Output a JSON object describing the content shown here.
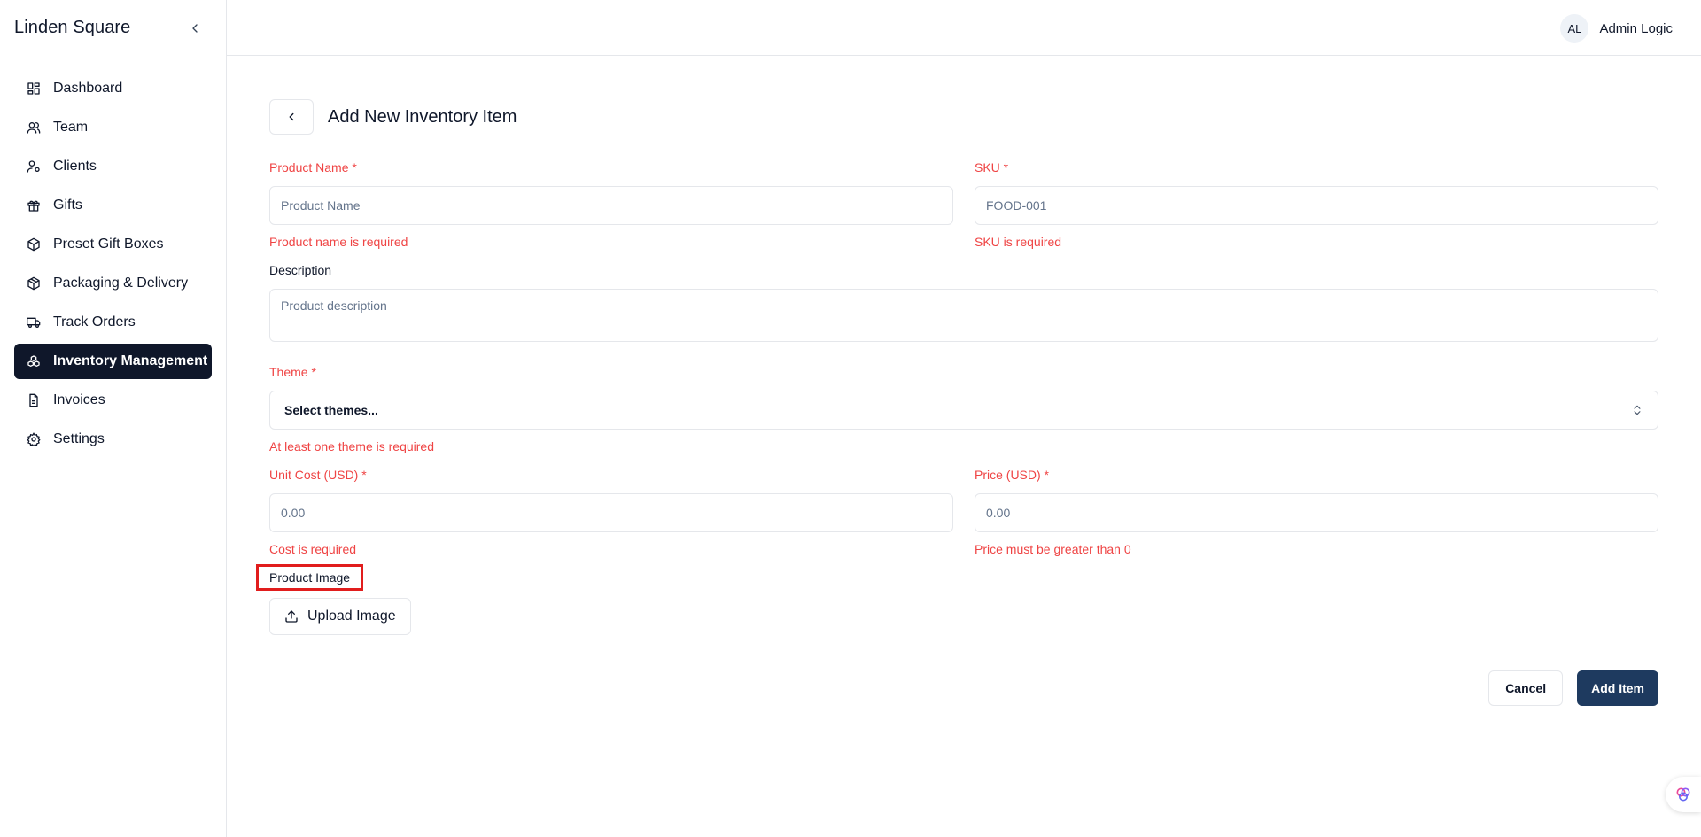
{
  "sidebar": {
    "brand": "Linden Square",
    "items": [
      {
        "label": "Dashboard",
        "icon": "dashboard-icon"
      },
      {
        "label": "Team",
        "icon": "users-icon"
      },
      {
        "label": "Clients",
        "icon": "user-cog-icon"
      },
      {
        "label": "Gifts",
        "icon": "gift-icon"
      },
      {
        "label": "Preset Gift Boxes",
        "icon": "box-icon"
      },
      {
        "label": "Packaging & Delivery",
        "icon": "package-icon"
      },
      {
        "label": "Track Orders",
        "icon": "truck-icon"
      },
      {
        "label": "Inventory Management",
        "icon": "boxes-icon"
      },
      {
        "label": "Invoices",
        "icon": "file-text-icon"
      },
      {
        "label": "Settings",
        "icon": "gear-icon"
      }
    ],
    "active_index": 7
  },
  "header": {
    "avatar_initials": "AL",
    "user_name": "Admin Logic"
  },
  "form": {
    "title": "Add New Inventory Item",
    "product_name": {
      "label": "Product Name *",
      "placeholder": "Product Name",
      "error": "Product name is required"
    },
    "sku": {
      "label": "SKU *",
      "placeholder": "FOOD-001",
      "error": "SKU is required"
    },
    "description": {
      "label": "Description",
      "placeholder": "Product description"
    },
    "theme": {
      "label": "Theme *",
      "value": "Select themes...",
      "error": "At least one theme is required"
    },
    "unit_cost": {
      "label": "Unit Cost (USD) *",
      "placeholder": "0.00",
      "error": "Cost is required"
    },
    "price": {
      "label": "Price (USD) *",
      "placeholder": "0.00",
      "error": "Price must be greater than 0"
    },
    "product_image": {
      "label": "Product Image",
      "button": "Upload Image"
    },
    "cancel_label": "Cancel",
    "submit_label": "Add Item"
  },
  "colors": {
    "error": "#ef4444",
    "primary": "#1e3a5f",
    "sidebar_active": "#0f172a",
    "highlight_box": "#e11d1d"
  }
}
